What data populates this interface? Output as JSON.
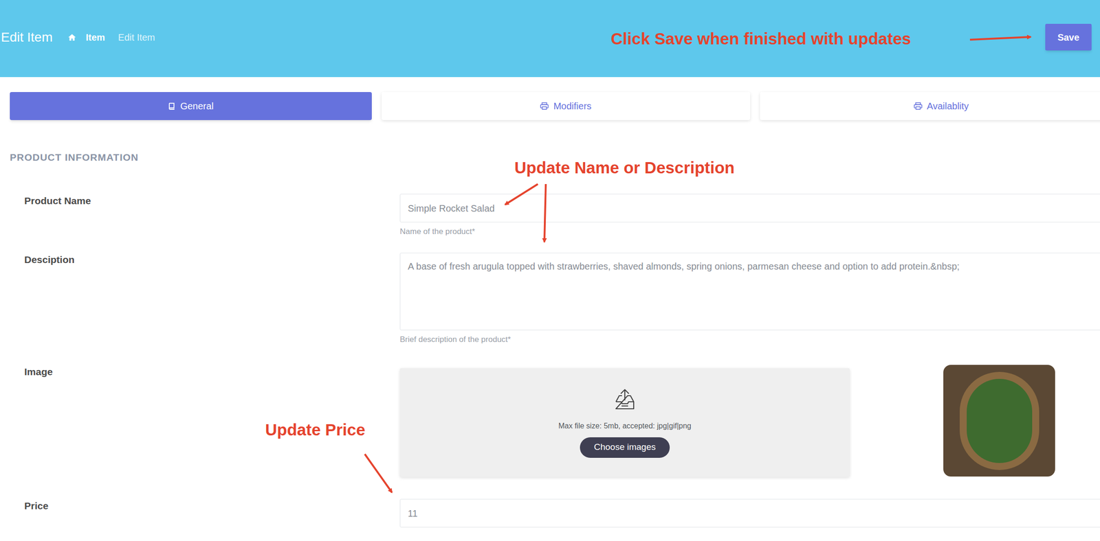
{
  "header": {
    "title": "Edit Item",
    "breadcrumb": [
      {
        "label": "Item",
        "current": false
      },
      {
        "label": "Edit Item",
        "current": true
      }
    ],
    "save": "Save"
  },
  "tabs": [
    {
      "label": "General",
      "selected": true
    },
    {
      "label": "Modifiers",
      "selected": false
    },
    {
      "label": "Availablity",
      "selected": false
    }
  ],
  "section": "PRODUCT INFORMATION",
  "fields": [
    {
      "kind": "text",
      "label": "Product Name",
      "value": "Simple Rocket Salad",
      "help": "Name of the product*"
    },
    {
      "kind": "textarea",
      "label": "Desciption",
      "value": "A base of fresh arugula topped with strawberries, shaved almonds, spring onions, parmesan cheese and option to add protein.&nbsp;",
      "help": "Brief description of the product*"
    },
    {
      "kind": "image",
      "label": "Image",
      "hint": "Max file size: 5mb, accepted: jpg|gif|png",
      "button": "Choose images"
    },
    {
      "kind": "text",
      "label": "Price",
      "value": "11"
    }
  ],
  "annotations": [
    {
      "text": "Click Save when finished with updates"
    },
    {
      "text": "Update Name or Description"
    },
    {
      "text": "Update Price"
    }
  ]
}
